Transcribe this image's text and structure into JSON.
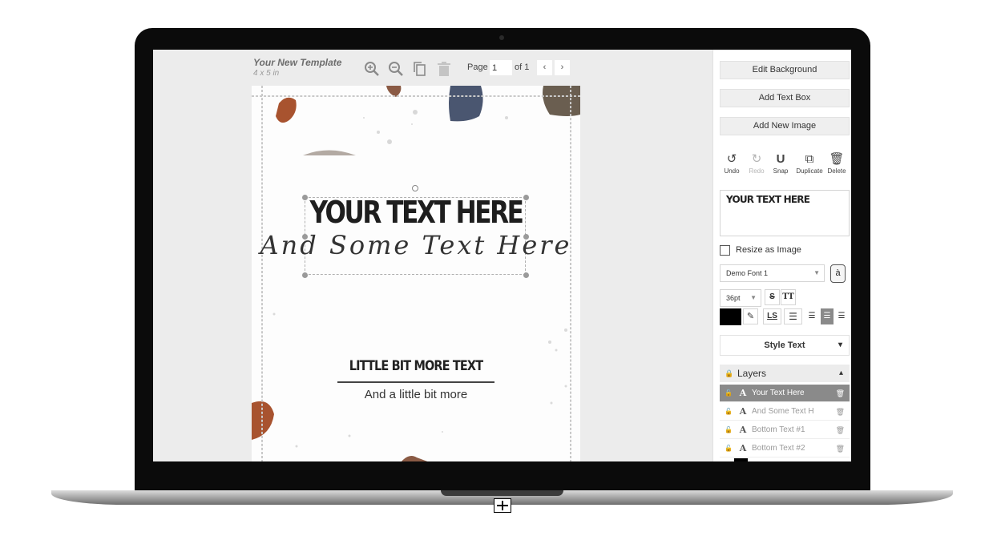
{
  "template": {
    "title": "Your New Template",
    "size": "4 x 5 in"
  },
  "toolbar": {
    "zoom_in_icon": "zoom-in-icon",
    "zoom_out_icon": "zoom-out-icon",
    "copy_icon": "copy-icon",
    "trash_icon": "trash-icon",
    "page_label": "Page",
    "page_value": "1",
    "page_of": "of 1",
    "prev": "‹",
    "next": "›"
  },
  "canvas": {
    "main_text": "YOUR TEXT HERE",
    "script_text": "And Some Text Here",
    "mid_text": "LITTLE BIT MORE TEXT",
    "small_text": "And a little bit more"
  },
  "panel": {
    "edit_background": "Edit Background",
    "add_text_box": "Add Text Box",
    "add_new_image": "Add New Image",
    "tools": [
      {
        "label": "Undo",
        "icon": "↺"
      },
      {
        "label": "Redo",
        "icon": "↻"
      },
      {
        "label": "Snap",
        "icon": "U"
      },
      {
        "label": "Duplicate",
        "icon": "⧉"
      },
      {
        "label": "Delete",
        "icon": "🗑"
      }
    ],
    "textarea_value": "YOUR TEXT HERE",
    "resize_label": "Resize as Image",
    "font_value": "Demo Font 1",
    "glyph": "à",
    "size_value": "36pt",
    "strike": "S",
    "caps": "TT",
    "ls": "LS",
    "color": "#000000",
    "style_text": "Style Text",
    "layers_title": "Layers",
    "layers": [
      {
        "name": "Your Text Here",
        "active": true
      },
      {
        "name": "And Some Text H",
        "active": false
      },
      {
        "name": "Bottom Text #1",
        "active": false
      },
      {
        "name": "Bottom Text #2",
        "active": false
      }
    ]
  }
}
